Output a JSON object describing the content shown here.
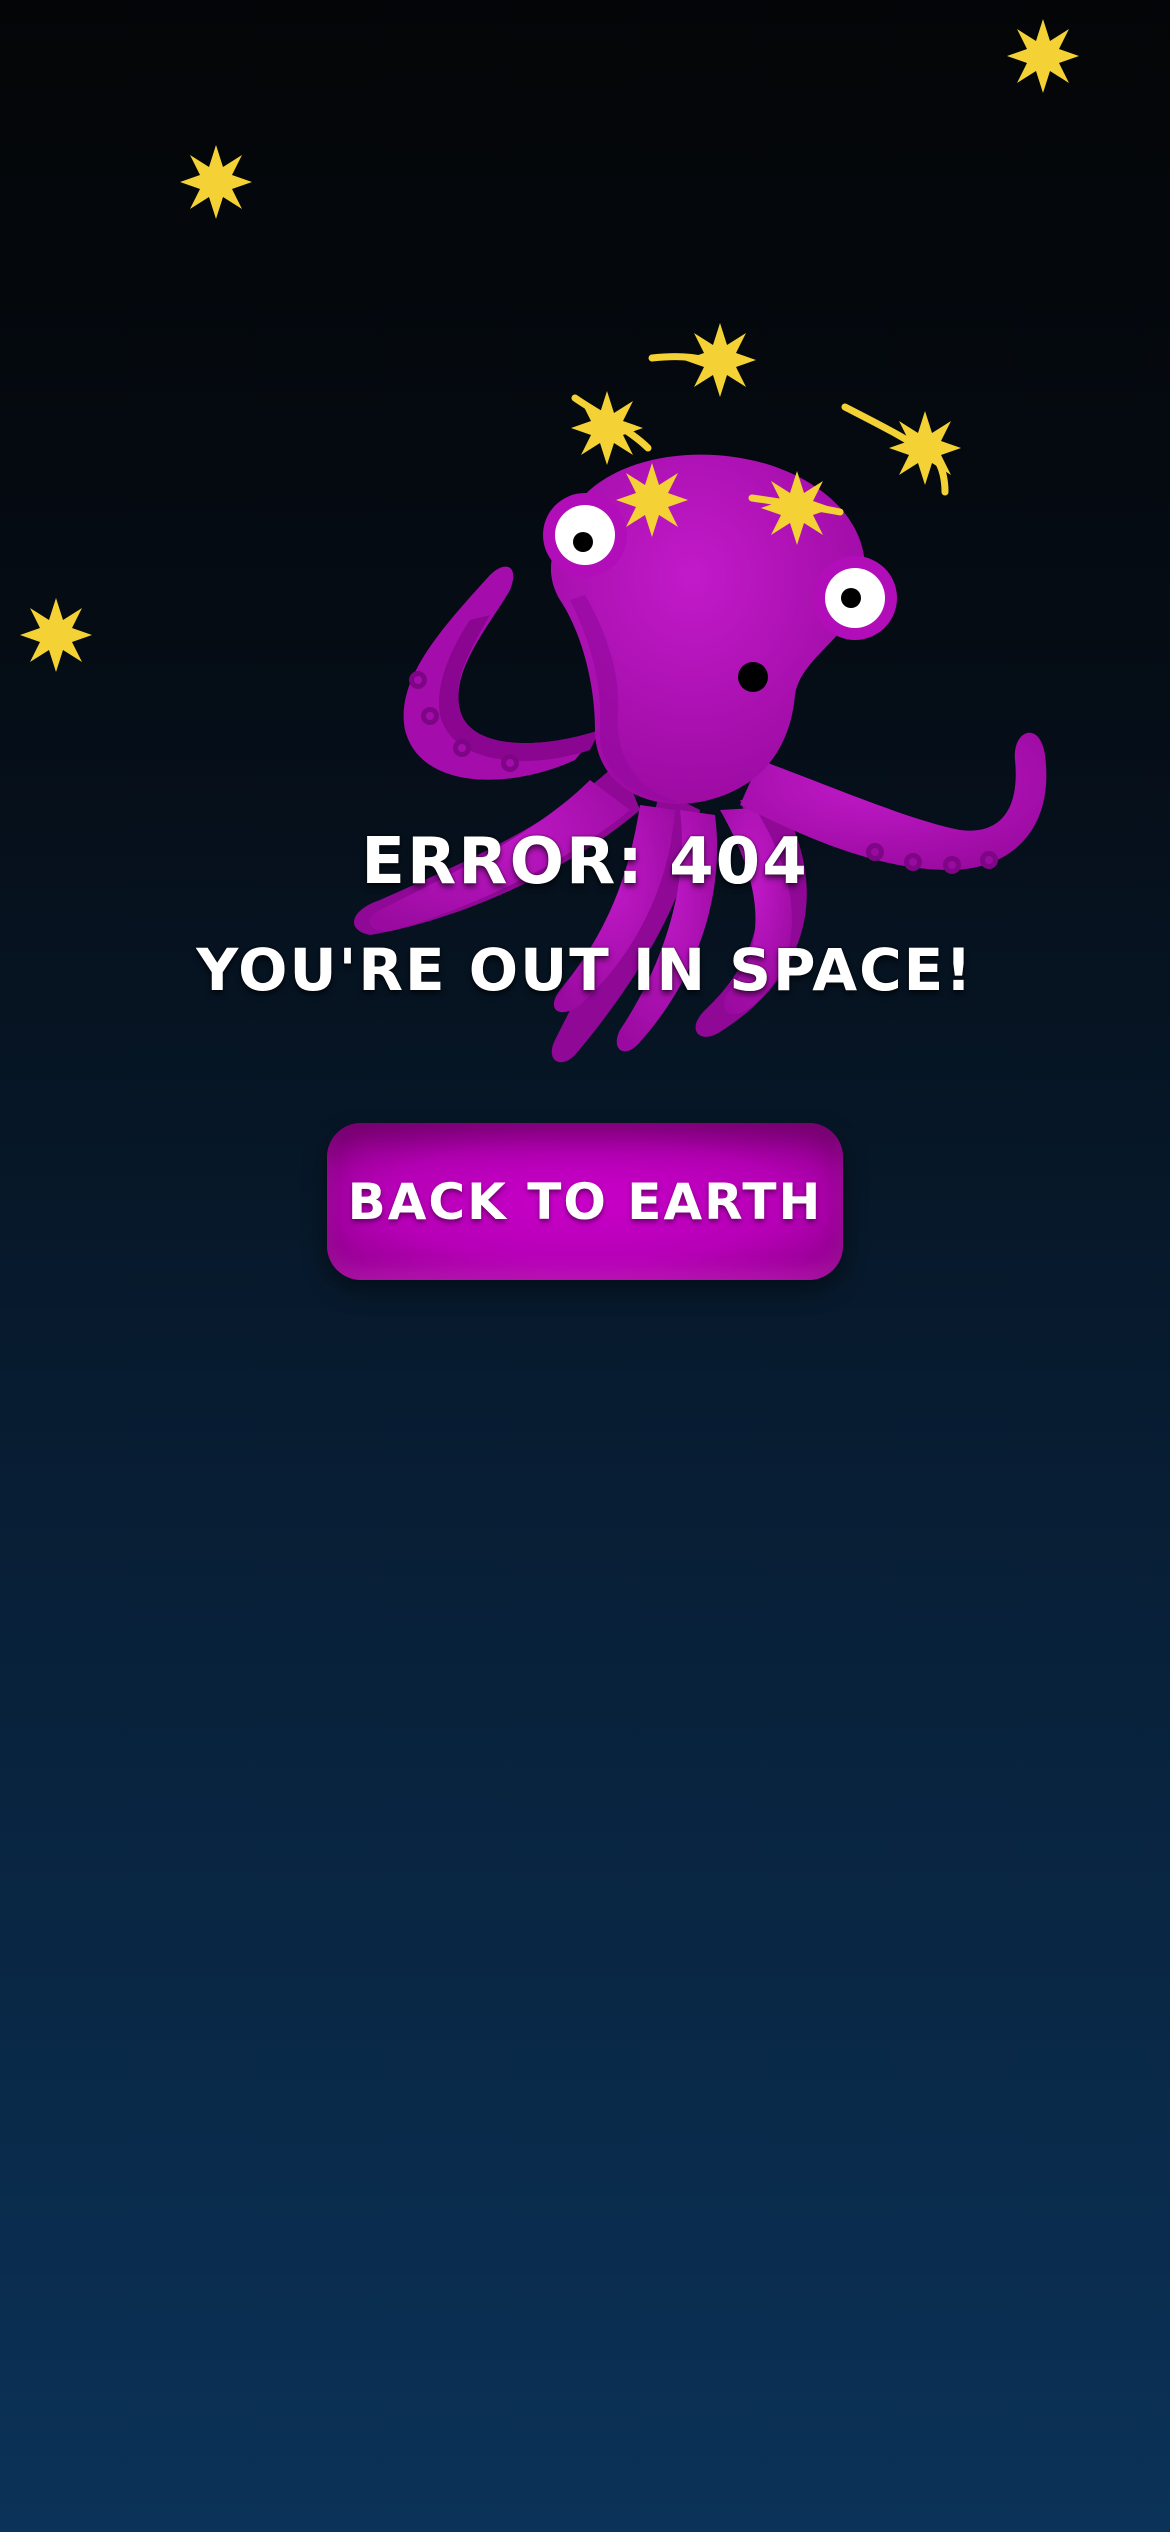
{
  "error": {
    "title": "ERROR: 404",
    "subtitle": "YOU'RE OUT IN SPACE!"
  },
  "actions": {
    "back_label": "BACK TO EARTH"
  },
  "colors": {
    "octopus": "#b10db8",
    "star": "#f4d235",
    "button": "#c000c0",
    "text": "#ffffff"
  },
  "icons": [
    "star-icon",
    "octopus-illustration"
  ]
}
